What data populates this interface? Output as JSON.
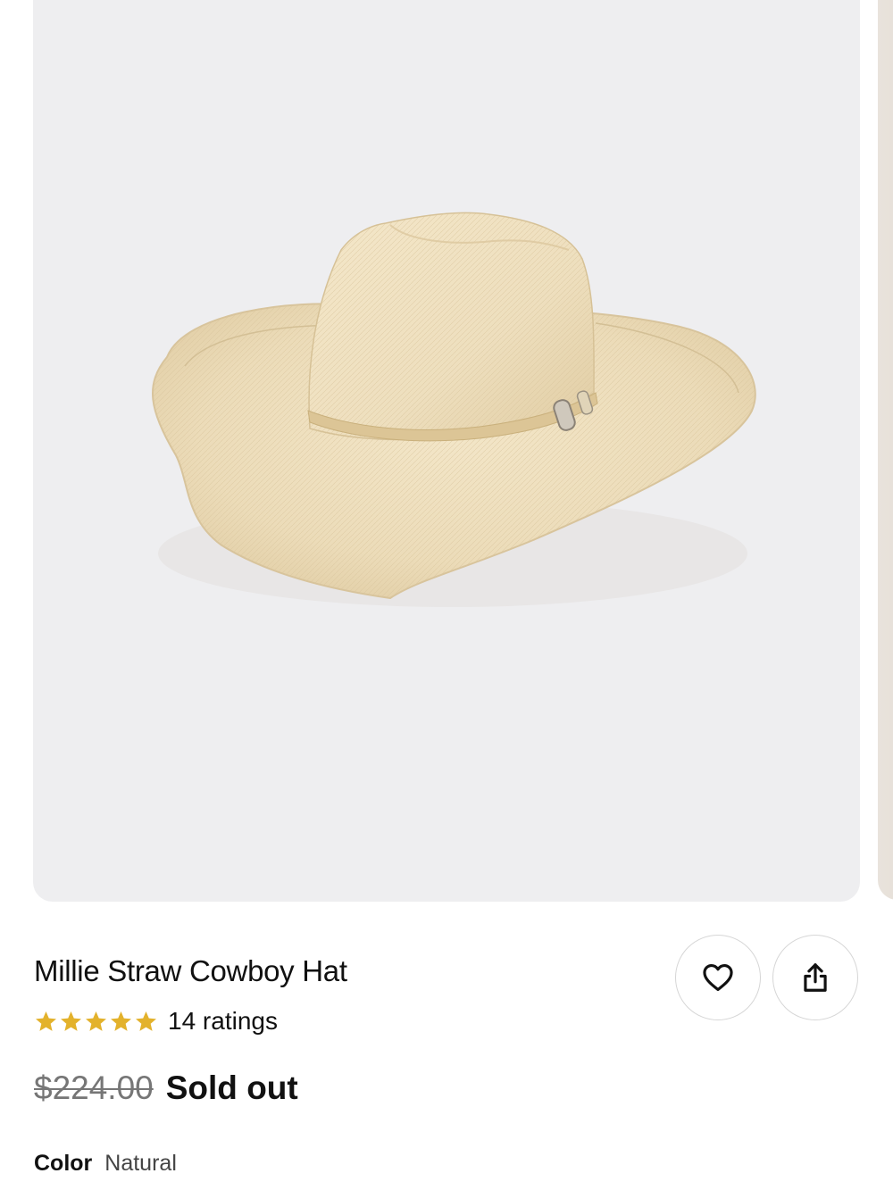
{
  "product": {
    "title": "Millie Straw Cowboy Hat",
    "rating_stars": 5,
    "ratings_label": "14 ratings",
    "original_price": "$224.00",
    "status": "Sold out",
    "color_label": "Color",
    "color_value": "Natural"
  },
  "icons": {
    "favorite": "heart-icon",
    "share": "share-icon",
    "star": "star-icon"
  },
  "colors": {
    "star": "#e3b22c",
    "image_bg": "#eeeef0",
    "hat": "#eedfbf",
    "band": "#dcc696"
  }
}
